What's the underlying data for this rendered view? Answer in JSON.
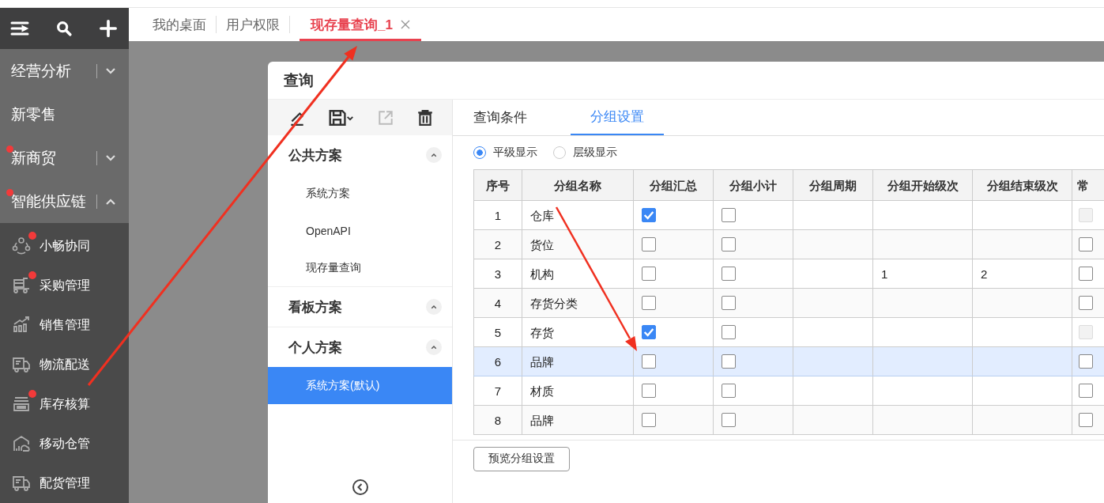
{
  "sidebar": {
    "groups": [
      {
        "label": "经营分析",
        "kind": "folder",
        "expanded": false,
        "badge": false
      },
      {
        "label": "新零售",
        "kind": "link",
        "badge": false
      },
      {
        "label": "新商贸",
        "kind": "folder",
        "expanded": false,
        "badge": true
      },
      {
        "label": "智能供应链",
        "kind": "folder",
        "expanded": true,
        "badge": true
      }
    ],
    "items": [
      {
        "label": "小畅协同",
        "badge": true
      },
      {
        "label": "采购管理",
        "badge": true
      },
      {
        "label": "销售管理",
        "badge": false
      },
      {
        "label": "物流配送",
        "badge": false
      },
      {
        "label": "库存核算",
        "badge": true
      },
      {
        "label": "移动仓管",
        "badge": false
      },
      {
        "label": "配货管理",
        "badge": false
      }
    ]
  },
  "tabs": [
    {
      "label": "我的桌面",
      "selected": false
    },
    {
      "label": "用户权限",
      "selected": false
    },
    {
      "label": "现存量查询_1",
      "selected": true
    }
  ],
  "dialog": {
    "title": "查询",
    "schemes": [
      {
        "title": "公共方案",
        "expanded": true,
        "items": [
          {
            "label": "系统方案",
            "selected": false
          },
          {
            "label": "OpenAPI",
            "selected": false
          },
          {
            "label": "现存量查询",
            "selected": false
          }
        ]
      },
      {
        "title": "看板方案",
        "expanded": true
      },
      {
        "title": "个人方案",
        "expanded": true,
        "items": [
          {
            "label": "系统方案(默认)",
            "selected": true
          }
        ]
      }
    ],
    "tabs": [
      {
        "label": "查询条件",
        "selected": false
      },
      {
        "label": "分组设置",
        "selected": true
      }
    ],
    "display_modes": [
      {
        "label": "平级显示",
        "selected": true
      },
      {
        "label": "层级显示",
        "selected": false
      }
    ],
    "table": {
      "columns": [
        "序号",
        "分组名称",
        "分组汇总",
        "分组小计",
        "分组周期",
        "分组开始级次",
        "分组结束级次",
        "常"
      ],
      "rows": [
        {
          "index": "1",
          "name": "仓库",
          "summary": true,
          "subtotal": false,
          "column_8": false,
          "column_8_disabled": true,
          "selected": false
        },
        {
          "index": "2",
          "name": "货位",
          "summary": false,
          "subtotal": false,
          "column_8": false,
          "column_8_disabled": false,
          "selected": false
        },
        {
          "index": "3",
          "name": "机构",
          "summary": false,
          "subtotal": false,
          "start_level": "1",
          "end_level": "2",
          "column_8": false,
          "column_8_disabled": false,
          "selected": false
        },
        {
          "index": "4",
          "name": "存货分类",
          "summary": false,
          "subtotal": false,
          "column_8": false,
          "column_8_disabled": false,
          "selected": false
        },
        {
          "index": "5",
          "name": "存货",
          "summary": true,
          "subtotal": false,
          "column_8": false,
          "column_8_disabled": true,
          "selected": false
        },
        {
          "index": "6",
          "name": "品牌",
          "summary": false,
          "subtotal": false,
          "column_8": false,
          "column_8_disabled": false,
          "selected": true
        },
        {
          "index": "7",
          "name": "材质",
          "summary": false,
          "subtotal": false,
          "column_8": false,
          "column_8_disabled": false,
          "selected": false
        },
        {
          "index": "8",
          "name": "品牌",
          "summary": false,
          "subtotal": false,
          "column_8": false,
          "column_8_disabled": false,
          "selected": false
        }
      ]
    },
    "preview_button": "预览分组设置"
  }
}
